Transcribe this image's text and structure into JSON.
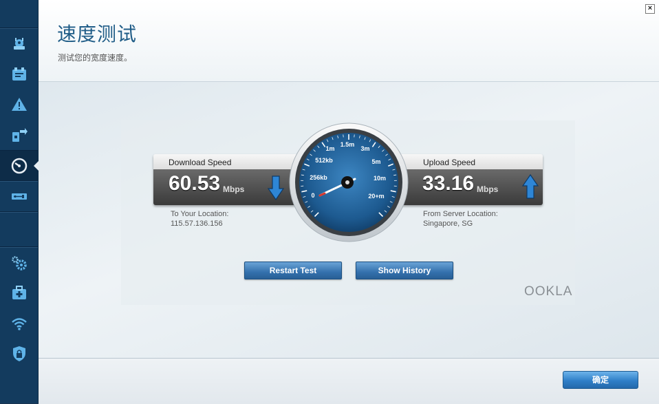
{
  "header": {
    "title": "速度测试",
    "subtitle": "测试您的宽度速度。",
    "close_label": "×"
  },
  "sidebar": {
    "items": [
      {
        "icon": "router-icon"
      },
      {
        "icon": "devices-icon"
      },
      {
        "icon": "alert-icon"
      },
      {
        "icon": "transfer-icon"
      },
      {
        "icon": "speedometer-icon",
        "active": true
      },
      {
        "icon": "usb-icon"
      },
      {
        "icon": "gears-icon"
      },
      {
        "icon": "medkit-icon"
      },
      {
        "icon": "wifi-icon"
      },
      {
        "icon": "lock-shield-icon"
      }
    ]
  },
  "speedtest": {
    "download": {
      "label": "Download Speed",
      "value": "60.53",
      "unit": "Mbps",
      "location_label": "To Your Location:",
      "location_value": "115.57.136.156"
    },
    "upload": {
      "label": "Upload Speed",
      "value": "33.16",
      "unit": "Mbps",
      "location_label": "From Server Location:",
      "location_value": "Singapore, SG"
    },
    "gauge_labels": [
      "0",
      "256kb",
      "512kb",
      "1m",
      "1.5m",
      "3m",
      "5m",
      "10m",
      "20+m"
    ],
    "restart_label": "Restart Test",
    "history_label": "Show History",
    "brand": "OOKLA"
  },
  "footer": {
    "ok_label": "确定"
  },
  "colors": {
    "accent": "#2f7fc8",
    "title": "#1f5c87",
    "sidebar": "#133b5e",
    "arrow": "#2e86d6"
  }
}
